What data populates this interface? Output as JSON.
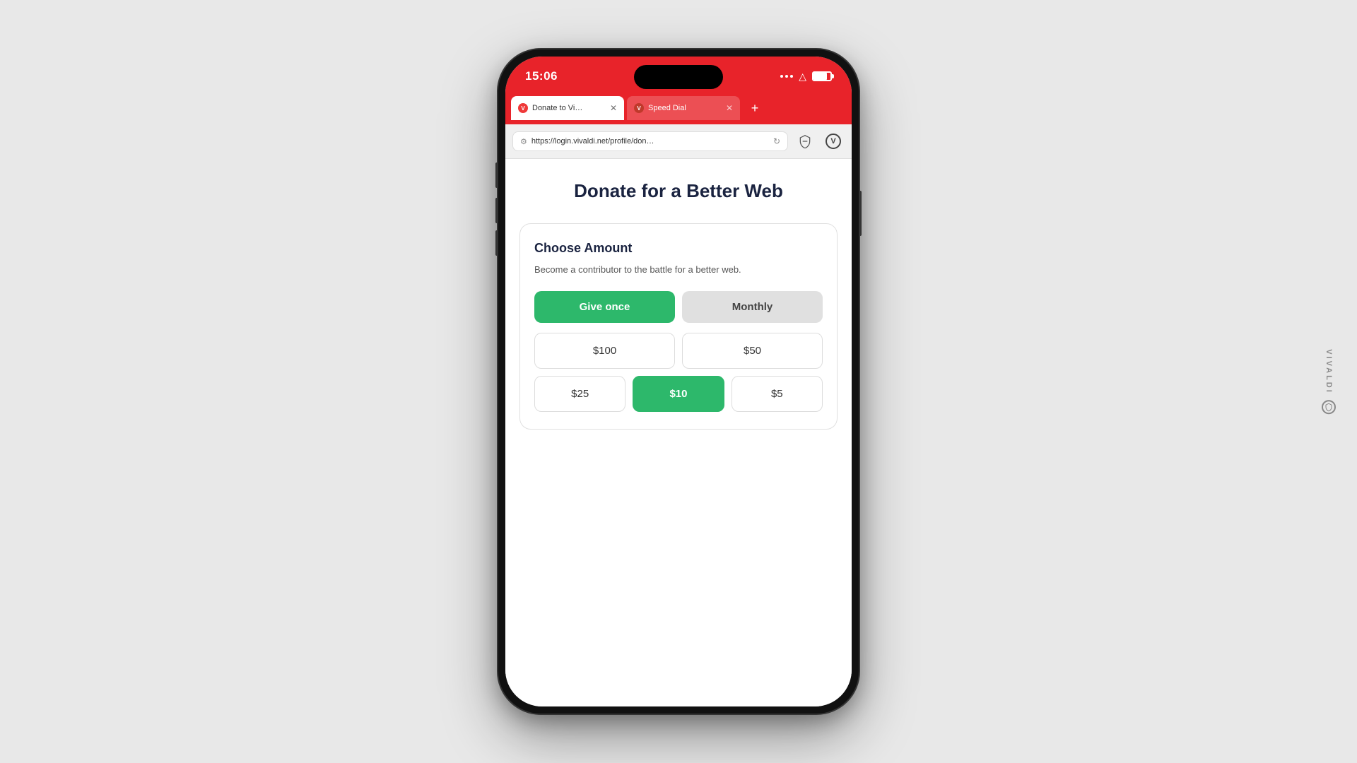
{
  "phone": {
    "status_time": "15:06",
    "background_color": "#e8e8e8"
  },
  "browser": {
    "tabs": [
      {
        "label": "Donate to Vi…",
        "active": true,
        "icon": "vivaldi-icon"
      },
      {
        "label": "Speed Dial",
        "active": false,
        "icon": "vivaldi-icon"
      }
    ],
    "url": "https://login.vivaldi.net/profile/don…",
    "new_tab_label": "+"
  },
  "page": {
    "title": "Donate for a Better Web",
    "card": {
      "heading": "Choose Amount",
      "description": "Become a contributor to the battle for a better web.",
      "frequency_buttons": [
        {
          "label": "Give once",
          "active": true
        },
        {
          "label": "Monthly",
          "active": false
        }
      ],
      "amount_buttons_row1": [
        {
          "label": "$100",
          "selected": false
        },
        {
          "label": "$50",
          "selected": false
        }
      ],
      "amount_buttons_row2": [
        {
          "label": "$25",
          "selected": false
        },
        {
          "label": "$10",
          "selected": true
        },
        {
          "label": "$5",
          "selected": false
        }
      ]
    }
  },
  "vivaldi_watermark": {
    "text": "VIVALDI"
  }
}
